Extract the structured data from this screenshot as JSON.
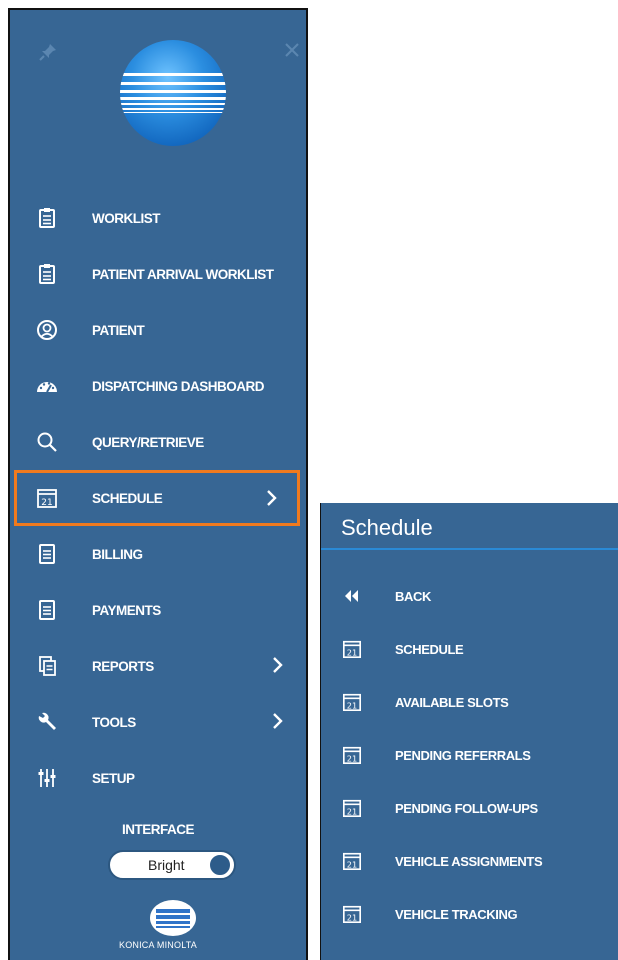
{
  "sidebar": {
    "items": [
      {
        "label": "WORKLIST",
        "icon": "clipboard-icon"
      },
      {
        "label": "PATIENT ARRIVAL WORKLIST",
        "icon": "clipboard-icon"
      },
      {
        "label": "PATIENT",
        "icon": "patient-icon"
      },
      {
        "label": "DISPATCHING DASHBOARD",
        "icon": "dashboard-icon"
      },
      {
        "label": "QUERY/RETRIEVE",
        "icon": "search-icon"
      },
      {
        "label": "SCHEDULE",
        "icon": "calendar-icon",
        "selected": true,
        "has_submenu": true
      },
      {
        "label": "BILLING",
        "icon": "document-icon"
      },
      {
        "label": "PAYMENTS",
        "icon": "document-icon"
      },
      {
        "label": "REPORTS",
        "icon": "reports-icon",
        "has_submenu": true
      },
      {
        "label": "TOOLS",
        "icon": "wrench-icon",
        "has_submenu": true
      },
      {
        "label": "SETUP",
        "icon": "sliders-icon"
      }
    ],
    "interface_label": "INTERFACE",
    "theme_toggle_value": "Bright",
    "brand_name": "KONICA MINOLTA",
    "calendar_icon_text": "21"
  },
  "submenu": {
    "title": "Schedule",
    "items": [
      {
        "label": "BACK",
        "icon": "double-chevron-left-icon"
      },
      {
        "label": "SCHEDULE",
        "icon": "calendar-icon"
      },
      {
        "label": "AVAILABLE SLOTS",
        "icon": "calendar-icon"
      },
      {
        "label": "PENDING REFERRALS",
        "icon": "calendar-icon"
      },
      {
        "label": "PENDING FOLLOW-UPS",
        "icon": "calendar-icon"
      },
      {
        "label": "VEHICLE ASSIGNMENTS",
        "icon": "calendar-icon"
      },
      {
        "label": "VEHICLE TRACKING",
        "icon": "calendar-icon"
      }
    ]
  },
  "colors": {
    "panel_bg": "#376694",
    "selection_border": "#f07a1e",
    "title_underline": "#2a8ad6"
  }
}
